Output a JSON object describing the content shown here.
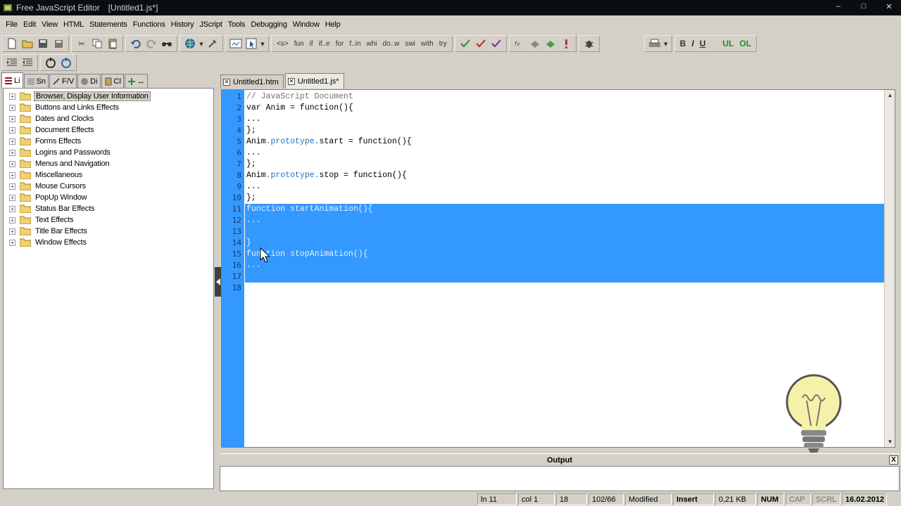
{
  "window": {
    "title": "Free JavaScript Editor",
    "document_title": "[Untitled1.js*]",
    "controls": [
      "–",
      "□",
      "✕"
    ]
  },
  "menu": [
    "File",
    "Edit",
    "View",
    "HTML",
    "Statements",
    "Functions",
    "History",
    "JScript",
    "Tools",
    "Debugging",
    "Window",
    "Help"
  ],
  "toolbar": {
    "statements": [
      "<s>",
      "fun",
      "if",
      "if..e",
      "for",
      "f..in",
      "whi",
      "do..w",
      "swi",
      "with",
      "try"
    ],
    "format": {
      "bold": "B",
      "italic": "I",
      "underline": "U",
      "ul": "UL",
      "ol": "OL"
    }
  },
  "left_tabs": [
    "Li",
    "Sn",
    "F/V",
    "Di",
    "Cl",
    "↔"
  ],
  "tree": [
    {
      "label": "Browser, Display User Information",
      "selected": true
    },
    {
      "label": "Buttons and Links Effects"
    },
    {
      "label": "Dates and Clocks"
    },
    {
      "label": "Document Effects"
    },
    {
      "label": "Forms Effects"
    },
    {
      "label": "Logins and Passwords"
    },
    {
      "label": "Menus and Navigation"
    },
    {
      "label": "Miscellaneous"
    },
    {
      "label": "Mouse Cursors"
    },
    {
      "label": "PopUp Window"
    },
    {
      "label": "Status Bar Effects"
    },
    {
      "label": "Text Effects"
    },
    {
      "label": "Title Bar Effects"
    },
    {
      "label": "Window Effects"
    }
  ],
  "doc_tabs": [
    {
      "label": "Untitled1.htm",
      "active": false
    },
    {
      "label": "Untitled1.js*",
      "active": true
    }
  ],
  "editor": {
    "line_numbers": [
      "1",
      "2",
      "3",
      "4",
      "5",
      "6",
      "7",
      "8",
      "9",
      "10",
      "11",
      "12",
      "13",
      "14",
      "15",
      "16",
      "17",
      "18"
    ],
    "lines": [
      "// JavaScript Document",
      "var Anim = function(){",
      "...",
      "};",
      "Anim.prototype.start = function(){",
      "...",
      "};",
      "Anim.prototype.stop = function(){",
      "...",
      "};",
      "function startAnimation(){",
      "...",
      "",
      "}",
      "function stopAnimation(){",
      "...",
      "",
      "}"
    ],
    "selected_from_line": 11,
    "selected_to_line": 18
  },
  "output": {
    "title": "Output",
    "close": "X"
  },
  "status": {
    "line": "ln 11",
    "col": "col 1",
    "total_lines": "18",
    "chars": "102/66",
    "modified": "Modified",
    "mode": "Insert",
    "size": "0,21 KB",
    "num": "NUM",
    "cap": "CAP",
    "scrl": "SCRL",
    "date": "16.02.2012"
  },
  "colors": {
    "selection": "#3399ff",
    "titlebar": "#0b0e10",
    "chrome": "#d4d0c8"
  }
}
